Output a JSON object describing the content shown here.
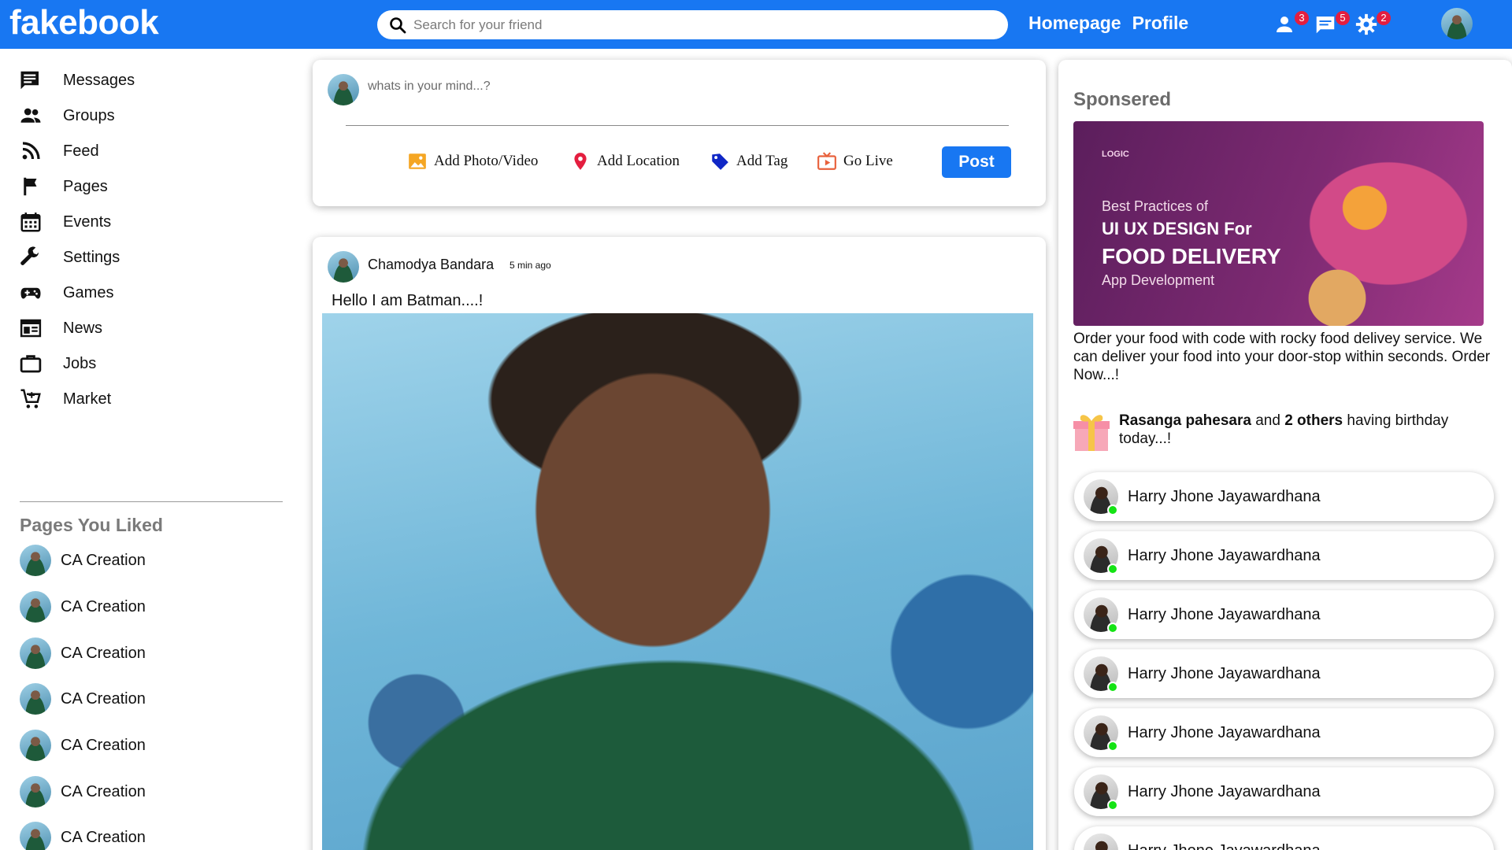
{
  "header": {
    "logo": "fakebook",
    "search_placeholder": "Search for your friend",
    "links": [
      "Homepage",
      "Profile"
    ],
    "badges": {
      "friends": "3",
      "messages": "5",
      "settings": "2"
    }
  },
  "sidebar": {
    "items": [
      {
        "label": "Messages",
        "icon": "messages-icon"
      },
      {
        "label": "Groups",
        "icon": "groups-icon"
      },
      {
        "label": "Feed",
        "icon": "feed-icon"
      },
      {
        "label": "Pages",
        "icon": "flag-icon"
      },
      {
        "label": "Events",
        "icon": "calendar-icon"
      },
      {
        "label": "Settings",
        "icon": "wrench-icon"
      },
      {
        "label": "Games",
        "icon": "gamepad-icon"
      },
      {
        "label": "News",
        "icon": "news-icon"
      },
      {
        "label": "Jobs",
        "icon": "briefcase-icon"
      },
      {
        "label": "Market",
        "icon": "cart-icon"
      }
    ],
    "liked_title": "Pages You Liked",
    "liked_pages": [
      "CA Creation",
      "CA Creation",
      "CA Creation",
      "CA Creation",
      "CA Creation",
      "CA Creation",
      "CA Creation"
    ]
  },
  "composer": {
    "placeholder": "whats in your mind...?",
    "options": [
      "Add Photo/Video",
      "Add Location",
      "Add Tag",
      "Go Live"
    ],
    "post_label": "Post"
  },
  "post": {
    "author": "Chamodya Bandara",
    "time": "5 min ago",
    "text": "Hello I am Batman....!"
  },
  "right": {
    "sponsored_title": "Sponsered",
    "ad": {
      "brand": "LOGIC",
      "line1": "Best Practices of",
      "line2": "UI UX DESIGN For",
      "line3": "FOOD DELIVERY",
      "line4": "App Development"
    },
    "ad_text": "Order your food with code with rocky food delivey service. We can deliver your food into your door-stop within seconds. Order Now...!",
    "birthday": {
      "name": "Rasanga pahesara",
      "and": "and",
      "others": "2 others",
      "suffix": "having birthday today...!"
    },
    "friends": [
      "Harry Jhone Jayawardhana",
      "Harry Jhone Jayawardhana",
      "Harry Jhone Jayawardhana",
      "Harry Jhone Jayawardhana",
      "Harry Jhone Jayawardhana",
      "Harry Jhone Jayawardhana",
      "Harry Jhone Jayawardhana"
    ]
  },
  "colors": {
    "brand": "#1877f2",
    "online": "#14e314",
    "badge": "#e41e3f"
  }
}
